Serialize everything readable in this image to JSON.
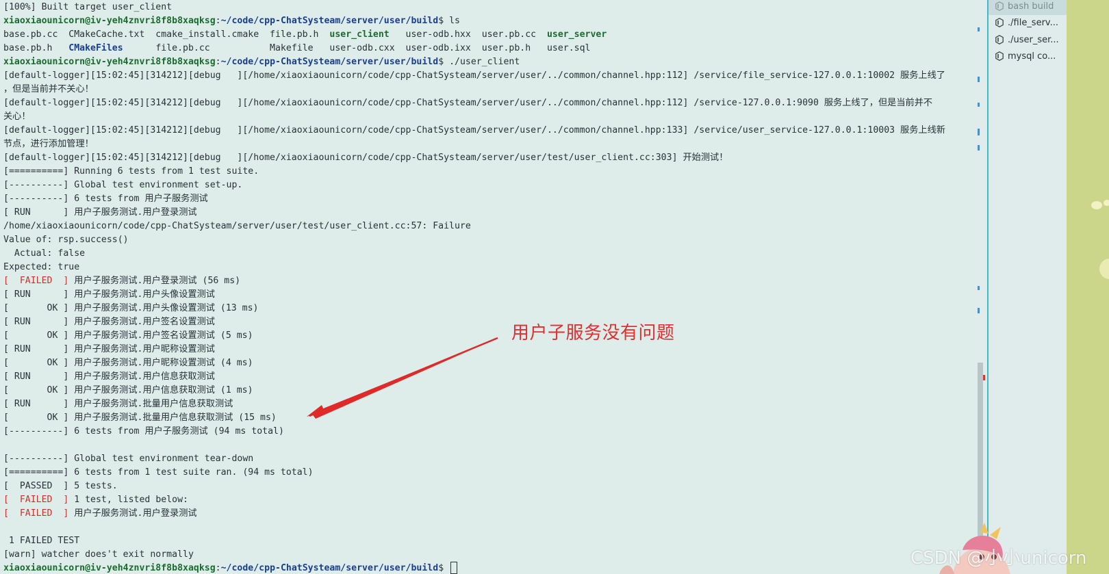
{
  "terminal": {
    "lines": [
      {
        "parts": [
          {
            "t": "[100%] Built target user_client"
          }
        ]
      },
      {
        "parts": [
          {
            "t": "xiaoxiaounicorn@iv-yeh4znvri8f8b8xaqksg",
            "c": "prompt-user"
          },
          {
            "t": ":"
          },
          {
            "t": "~/code/cpp-ChatSysteam/server/user/build",
            "c": "prompt-path"
          },
          {
            "t": "$ ls"
          }
        ]
      },
      {
        "parts": [
          {
            "t": "base.pb.cc  CMakeCache.txt  cmake_install.cmake  file.pb.h  "
          },
          {
            "t": "user_client",
            "c": "exe"
          },
          {
            "t": "   user-odb.hxx  user.pb.cc  "
          },
          {
            "t": "user_server",
            "c": "exe"
          }
        ]
      },
      {
        "parts": [
          {
            "t": "base.pb.h   "
          },
          {
            "t": "CMakeFiles",
            "c": "dir"
          },
          {
            "t": "      file.pb.cc           Makefile   user-odb.cxx  user-odb.ixx  user.pb.h   user.sql"
          }
        ]
      },
      {
        "parts": [
          {
            "t": "xiaoxiaounicorn@iv-yeh4znvri8f8b8xaqksg",
            "c": "prompt-user"
          },
          {
            "t": ":"
          },
          {
            "t": "~/code/cpp-ChatSysteam/server/user/build",
            "c": "prompt-path"
          },
          {
            "t": "$ ./user_client"
          }
        ]
      },
      {
        "parts": [
          {
            "t": "[default-logger][15:02:45][314212][debug   ][/home/xiaoxiaounicorn/code/cpp-ChatSysteam/server/user/../common/channel.hpp:112] /service/file_service-127.0.0.1:10002 服务上线了"
          }
        ]
      },
      {
        "parts": [
          {
            "t": "，但是当前并不关心！"
          }
        ]
      },
      {
        "parts": [
          {
            "t": "[default-logger][15:02:45][314212][debug   ][/home/xiaoxiaounicorn/code/cpp-ChatSysteam/server/user/../common/channel.hpp:112] /service-127.0.0.1:9090 服务上线了，但是当前并不"
          }
        ]
      },
      {
        "parts": [
          {
            "t": "关心！"
          }
        ]
      },
      {
        "parts": [
          {
            "t": "[default-logger][15:02:45][314212][debug   ][/home/xiaoxiaounicorn/code/cpp-ChatSysteam/server/user/../common/channel.hpp:133] /service/user_service-127.0.0.1:10003 服务上线新"
          }
        ]
      },
      {
        "parts": [
          {
            "t": "节点，进行添加管理！"
          }
        ]
      },
      {
        "parts": [
          {
            "t": "[default-logger][15:02:45][314212][debug   ][/home/xiaoxiaounicorn/code/cpp-ChatSysteam/server/user/test/user_client.cc:303] 开始测试！"
          }
        ]
      },
      {
        "parts": [
          {
            "t": "[==========] Running 6 tests from 1 test suite."
          }
        ]
      },
      {
        "parts": [
          {
            "t": "[----------] Global test environment set-up."
          }
        ]
      },
      {
        "parts": [
          {
            "t": "[----------] 6 tests from 用户子服务测试"
          }
        ]
      },
      {
        "parts": [
          {
            "t": "[ RUN      ] 用户子服务测试.用户登录测试"
          }
        ]
      },
      {
        "parts": [
          {
            "t": "/home/xiaoxiaounicorn/code/cpp-ChatSysteam/server/user/test/user_client.cc:57: Failure"
          }
        ]
      },
      {
        "parts": [
          {
            "t": "Value of: rsp.success()"
          }
        ]
      },
      {
        "parts": [
          {
            "t": "  Actual: false"
          }
        ]
      },
      {
        "parts": [
          {
            "t": "Expected: true"
          }
        ]
      },
      {
        "parts": [
          {
            "t": "[  FAILED  ]",
            "c": "fail"
          },
          {
            "t": " 用户子服务测试.用户登录测试 (56 ms)"
          }
        ]
      },
      {
        "parts": [
          {
            "t": "[ RUN      ] 用户子服务测试.用户头像设置测试"
          }
        ]
      },
      {
        "parts": [
          {
            "t": "[       OK ] 用户子服务测试.用户头像设置测试 (13 ms)"
          }
        ]
      },
      {
        "parts": [
          {
            "t": "[ RUN      ] 用户子服务测试.用户签名设置测试"
          }
        ]
      },
      {
        "parts": [
          {
            "t": "[       OK ] 用户子服务测试.用户签名设置测试 (5 ms)"
          }
        ]
      },
      {
        "parts": [
          {
            "t": "[ RUN      ] 用户子服务测试.用户昵称设置测试"
          }
        ]
      },
      {
        "parts": [
          {
            "t": "[       OK ] 用户子服务测试.用户昵称设置测试 (4 ms)"
          }
        ]
      },
      {
        "parts": [
          {
            "t": "[ RUN      ] 用户子服务测试.用户信息获取测试"
          }
        ]
      },
      {
        "parts": [
          {
            "t": "[       OK ] 用户子服务测试.用户信息获取测试 (1 ms)"
          }
        ]
      },
      {
        "parts": [
          {
            "t": "[ RUN      ] 用户子服务测试.批量用户信息获取测试"
          }
        ]
      },
      {
        "parts": [
          {
            "t": "[       OK ] 用户子服务测试.批量用户信息获取测试 (15 ms)"
          }
        ]
      },
      {
        "parts": [
          {
            "t": "[----------] 6 tests from 用户子服务测试 (94 ms total)"
          }
        ]
      },
      {
        "parts": [
          {
            "t": ""
          }
        ]
      },
      {
        "parts": [
          {
            "t": "[----------] Global test environment tear-down"
          }
        ]
      },
      {
        "parts": [
          {
            "t": "[==========] 6 tests from 1 test suite ran. (94 ms total)"
          }
        ]
      },
      {
        "parts": [
          {
            "t": "[  PASSED  ] 5 tests."
          }
        ]
      },
      {
        "parts": [
          {
            "t": "[  FAILED  ]",
            "c": "fail"
          },
          {
            "t": " 1 test, listed below:"
          }
        ]
      },
      {
        "parts": [
          {
            "t": "[  FAILED  ]",
            "c": "fail"
          },
          {
            "t": " 用户子服务测试.用户登录测试"
          }
        ]
      },
      {
        "parts": [
          {
            "t": ""
          }
        ]
      },
      {
        "parts": [
          {
            "t": " 1 FAILED TEST"
          }
        ]
      },
      {
        "parts": [
          {
            "t": "[warn] watcher does't exit normally"
          }
        ]
      },
      {
        "parts": [
          {
            "t": "xiaoxiaounicorn@iv-yeh4znvri8f8b8xaqksg",
            "c": "prompt-user"
          },
          {
            "t": ":"
          },
          {
            "t": "~/code/cpp-ChatSysteam/server/user/build",
            "c": "prompt-path"
          },
          {
            "t": "$ "
          }
        ],
        "cursor": true
      }
    ]
  },
  "side_panel": {
    "items": [
      {
        "label": "bash  build",
        "active": true
      },
      {
        "label": "./file_serv...",
        "active": false
      },
      {
        "label": "./user_ser...",
        "active": false
      },
      {
        "label": "mysql  co...",
        "active": false
      }
    ],
    "icon": "terminal-icon"
  },
  "annotation": {
    "text": "用户子服务没有问题",
    "color": "#e03030"
  },
  "watermark": {
    "text": "CSDN @小小unicorn"
  },
  "colors": {
    "terminal_bg": "#deecea",
    "prompt_user": "#1a6b2e",
    "prompt_path": "#1a3f8e",
    "failed": "#c6322f",
    "divider": "#43b7c8",
    "deco": "#cbd68a"
  }
}
